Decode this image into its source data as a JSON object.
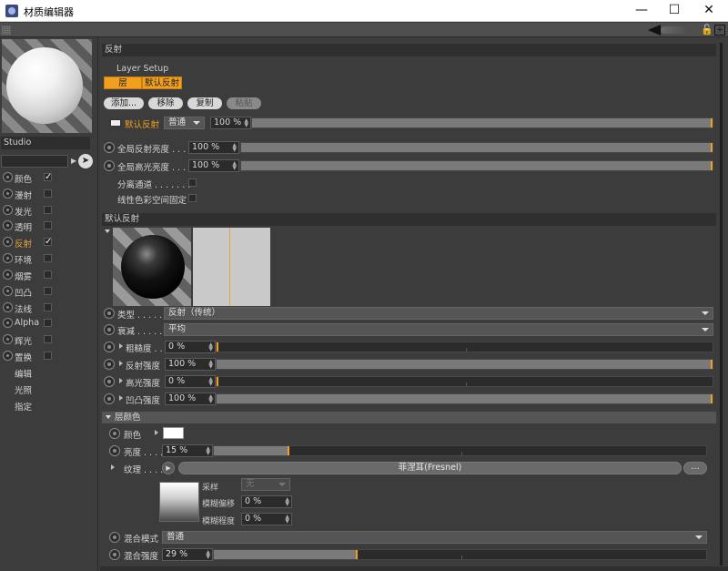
{
  "window": {
    "title": "材质编辑器",
    "minimize": "—",
    "maximize": "☐",
    "close": "✕"
  },
  "toolbar": {
    "icons": [
      "back-arrow-icon",
      "lock-icon",
      "new-window-icon"
    ]
  },
  "left": {
    "studio_label": "Studio",
    "channels": [
      {
        "label": "颜色",
        "checked": true
      },
      {
        "label": "漫射",
        "checked": false
      },
      {
        "label": "发光",
        "checked": false
      },
      {
        "label": "透明",
        "checked": false
      },
      {
        "label": "反射",
        "checked": true,
        "active": true
      },
      {
        "label": "环境",
        "checked": false
      },
      {
        "label": "烟雾",
        "checked": false
      },
      {
        "label": "凹凸",
        "checked": false
      },
      {
        "label": "法线",
        "checked": false
      },
      {
        "label": "Alpha",
        "checked": false
      },
      {
        "label": "辉光",
        "checked": false
      },
      {
        "label": "置换",
        "checked": false
      }
    ],
    "extra": [
      "编辑",
      "光照",
      "指定"
    ]
  },
  "reflect": {
    "header": "反射",
    "layer_setup": "Layer Setup",
    "tab_layer": "层",
    "tab_default": "默认反射",
    "btn_add": "添加...",
    "btn_remove": "移除",
    "btn_copy": "复制",
    "btn_paste": "粘贴",
    "default_row": {
      "label": "默认反射",
      "mode": "普通",
      "value": "100 %"
    },
    "global_reflect": {
      "label": "全局反射亮度 . . .",
      "value": "100 %",
      "level": 1.0
    },
    "global_spec": {
      "label": "全局高光亮度 . . .",
      "value": "100 %",
      "level": 1.0
    },
    "sep_channel": "分离通道 . . . . . . .",
    "linear_space": "线性色彩空间固定"
  },
  "default_reflect": {
    "header": "默认反射",
    "type": {
      "label": "类型 . . . . .",
      "value": "反射（传统）"
    },
    "atten": {
      "label": "衰减 . . . . .",
      "value": "平均"
    },
    "roughness": {
      "label": "粗糙度 . . .",
      "value": "0 %",
      "level": 0.0
    },
    "refl_strength": {
      "label": "反射强度",
      "value": "100 %",
      "level": 1.0
    },
    "spec_strength": {
      "label": "高光强度",
      "value": "0 %",
      "level": 0.0
    },
    "bump_strength": {
      "label": "凹凸强度",
      "value": "100 %",
      "level": 1.0
    }
  },
  "layer_color": {
    "header": "层颜色",
    "color_label": "颜色",
    "color": "#ffffff",
    "brightness": {
      "label": "亮度 . . . . .",
      "value": "15 %",
      "level": 0.15
    },
    "texture": {
      "label": "纹理 . . . . .",
      "shader": "菲涅耳(Fresnel)",
      "more": "..."
    },
    "sampling": {
      "label": "采样",
      "value": "无"
    },
    "blur_offset": {
      "label": "模糊偏移",
      "value": "0 %"
    },
    "blur_scale": {
      "label": "模糊程度",
      "value": "0 %"
    },
    "blend_mode": {
      "label": "混合模式",
      "value": "普通"
    },
    "blend_strength": {
      "label": "混合强度",
      "value": "29 %",
      "level": 0.29
    }
  },
  "colors": {
    "accent": "#f0a01e",
    "panel": "#3c3c3c",
    "field": "#2b2b2b"
  }
}
